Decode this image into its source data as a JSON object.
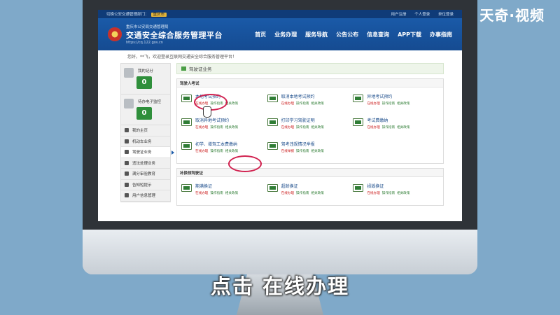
{
  "watermark": "天奇·视频",
  "subtitle": "点击 在线办理",
  "site": {
    "top_hint": "切换公安交通管理部门：",
    "city": "重庆市",
    "top_links": [
      "用户注册",
      "个人登录",
      "单位登录"
    ],
    "org": "重庆市公安局交通管理局",
    "title": "交通安全综合服务管理平台",
    "url": "https://cq.122.gov.cn",
    "nav": [
      "首页",
      "业务办理",
      "服务导航",
      "公告公布",
      "信息查询",
      "APP下载",
      "办事指南"
    ],
    "welcome": "您好，**飞，欢迎登录互联网交通安全综合服务管理平台！"
  },
  "sidebar": {
    "score_label": "我的记分",
    "score_value": "0",
    "monitor_label": "待办电子监控",
    "monitor_value": "0",
    "items": [
      "我的主页",
      "机动车业务",
      "驾驶证业务",
      "违法处理业务",
      "满分审验教育",
      "告知短提示",
      "用户信息管理"
    ]
  },
  "main": {
    "title": "驾驶证业务",
    "exam_section": "驾驶人考试",
    "exam_items": [
      {
        "name": "本地考试预约",
        "ops": [
          "在线办理",
          "操作指南",
          "相关政策"
        ]
      },
      {
        "name": "取消本地考试预约",
        "ops": [
          "在线办理",
          "操作指南",
          "相关政策"
        ]
      },
      {
        "name": "异地考试预约",
        "ops": [
          "在线办理",
          "操作指南",
          "相关政策"
        ]
      },
      {
        "name": "取消异地考试预约",
        "ops": [
          "在线办理",
          "操作指南",
          "相关政策"
        ]
      },
      {
        "name": "打印学习驾驶证明",
        "ops": [
          "在线办理",
          "操作指南",
          "相关政策"
        ]
      },
      {
        "name": "考试费缴纳",
        "ops": [
          "在线办理",
          "操作指南",
          "相关政策"
        ]
      },
      {
        "name": "初学、增驾工本费缴纳",
        "ops": [
          "在线办理",
          "操作指南",
          "相关政策"
        ]
      },
      {
        "name": "驾考违规情况举报",
        "ops": [
          "在线举报",
          "操作指南",
          "相关政策"
        ]
      }
    ],
    "renew_section": "补换领驾驶证",
    "renew_items": [
      {
        "name": "期满换证",
        "ops": [
          "在线办理",
          "操作指南",
          "相关政策"
        ]
      },
      {
        "name": "超龄换证",
        "ops": [
          "在线办理",
          "操作指南",
          "相关政策"
        ]
      },
      {
        "name": "损毁换证",
        "ops": [
          "在线办理",
          "操作指南",
          "相关政策"
        ]
      }
    ]
  }
}
